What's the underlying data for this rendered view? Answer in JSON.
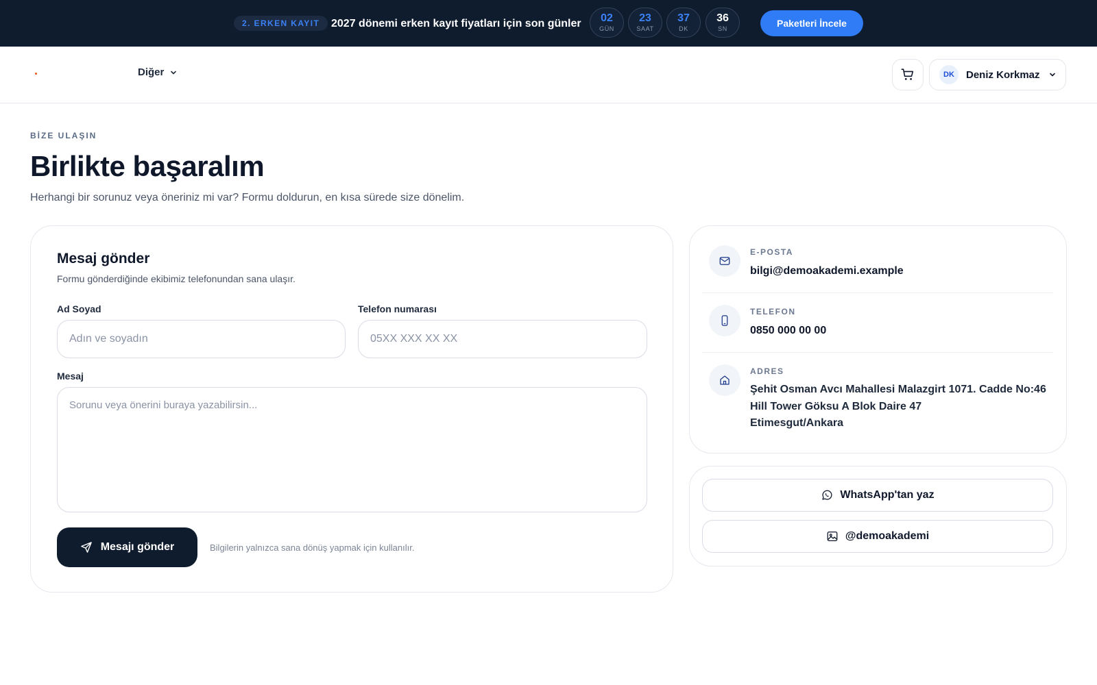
{
  "promo": {
    "badge": "2. ERKEN KAYIT",
    "text": "2027 dönemi erken kayıt fiyatları için son günler",
    "countdown": [
      {
        "value": "02",
        "unit": "GÜN"
      },
      {
        "value": "23",
        "unit": "SAAT"
      },
      {
        "value": "37",
        "unit": "DK"
      },
      {
        "value": "36",
        "unit": "SN"
      }
    ],
    "cta_label": "Paketleri İncele"
  },
  "header": {
    "nav_more_label": "Diğer",
    "user": {
      "initials": "DK",
      "name": "Deniz Korkmaz"
    }
  },
  "hero": {
    "eyebrow": "BİZE ULAŞIN",
    "title": "Birlikte başaralım",
    "subtitle": "Herhangi bir sorunuz veya öneriniz mi var? Formu doldurun, en kısa sürede size dönelim."
  },
  "form": {
    "title": "Mesaj gönder",
    "subtitle": "Formu gönderdiğinde ekibimiz telefonundan sana ulaşır.",
    "name_label": "Ad Soyad",
    "name_placeholder": "Adın ve soyadın",
    "name_value": "",
    "phone_label": "Telefon numarası",
    "phone_placeholder": "05XX XXX XX XX",
    "phone_value": "",
    "message_label": "Mesaj",
    "message_placeholder": "Sorunu veya önerini buraya yazabilirsin...",
    "message_value": "",
    "submit_label": "Mesajı gönder",
    "privacy_note": "Bilgilerin yalnızca sana dönüş yapmak için kullanılır."
  },
  "contact": {
    "email_label": "E-POSTA",
    "email_value": "bilgi@demoakademi.example",
    "phone_label": "TELEFON",
    "phone_value": "0850 000 00 00",
    "address_label": "ADRES",
    "address_lines": [
      "Şehit Osman Avcı Mahallesi Malazgirt 1071. Cadde No:46",
      "Hill Tower Göksu A Blok Daire 47",
      "Etimesgut/Ankara"
    ]
  },
  "social": {
    "whatsapp_label": "WhatsApp'tan yaz",
    "instagram_label": "@demoakademi"
  },
  "colors": {
    "dark": "#0f1c2e",
    "accent": "#2f7cf6",
    "countdown_value": "#3b82f6",
    "logo_dot": "#e8541f"
  }
}
